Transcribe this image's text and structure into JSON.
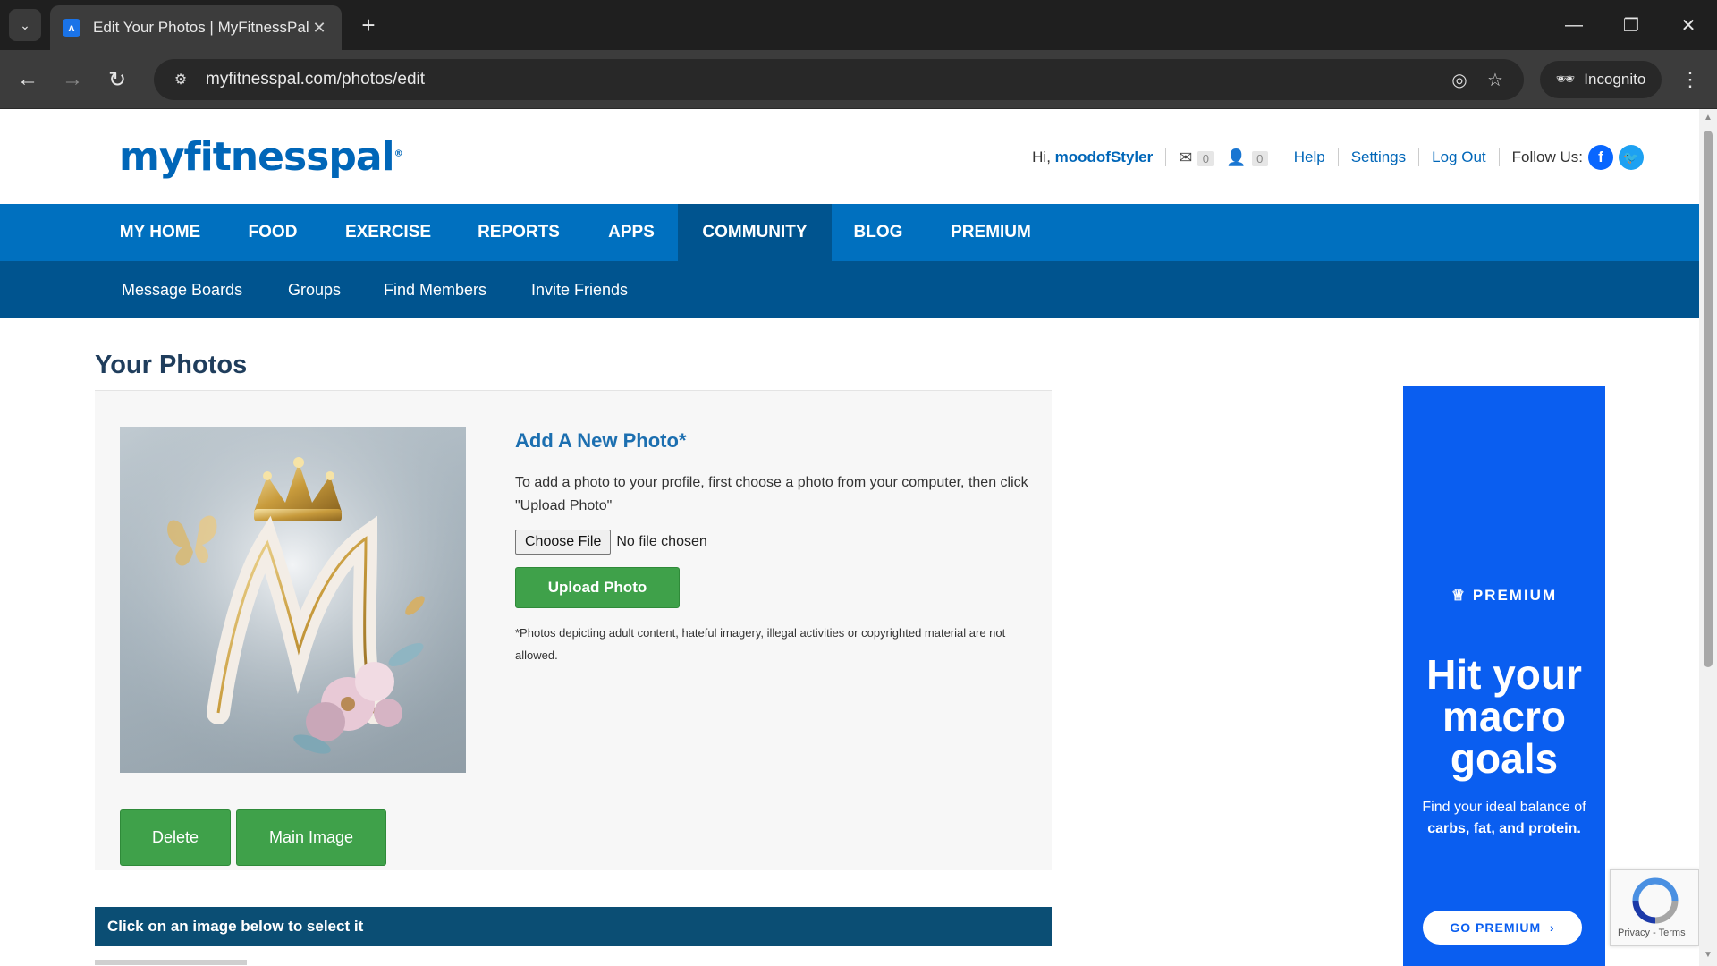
{
  "browser": {
    "tab_title": "Edit Your Photos | MyFitnessPal",
    "url": "myfitnesspal.com/photos/edit",
    "incognito_label": "Incognito"
  },
  "header": {
    "logo": "myfitnesspal",
    "greeting": "Hi,",
    "username": "moodofStyler",
    "messages_count": "0",
    "friends_count": "0",
    "help": "Help",
    "settings": "Settings",
    "logout": "Log Out",
    "follow_us": "Follow Us:"
  },
  "main_nav": [
    "MY HOME",
    "FOOD",
    "EXERCISE",
    "REPORTS",
    "APPS",
    "COMMUNITY",
    "BLOG",
    "PREMIUM"
  ],
  "active_nav": "COMMUNITY",
  "sub_nav": [
    "Message Boards",
    "Groups",
    "Find Members",
    "Invite Friends"
  ],
  "content": {
    "page_title": "Your Photos",
    "add_title": "Add A New Photo*",
    "add_desc": "To add a photo to your profile, first choose a photo from your computer, then click \"Upload Photo\"",
    "choose_file": "Choose File",
    "no_file": "No file chosen",
    "upload_button": "Upload Photo",
    "disclaimer": "*Photos depicting adult content, hateful imagery, illegal activities or copyrighted material are not allowed.",
    "delete_button": "Delete",
    "main_image_button": "Main Image",
    "select_hint": "Click on an image below to select it"
  },
  "ad": {
    "premium_label": "PREMIUM",
    "headline": "Hit your macro goals",
    "sub_prefix": "Find your ideal balance of ",
    "sub_bold": "carbs, fat, and protein.",
    "cta": "GO PREMIUM",
    "color": "#0a5ef0"
  },
  "recaptcha": {
    "terms": "Privacy - Terms"
  },
  "colors": {
    "brand_blue": "#0070bf",
    "nav_dark": "#00548f",
    "button_green": "#3fa14a",
    "select_bar": "#0b4e74"
  }
}
